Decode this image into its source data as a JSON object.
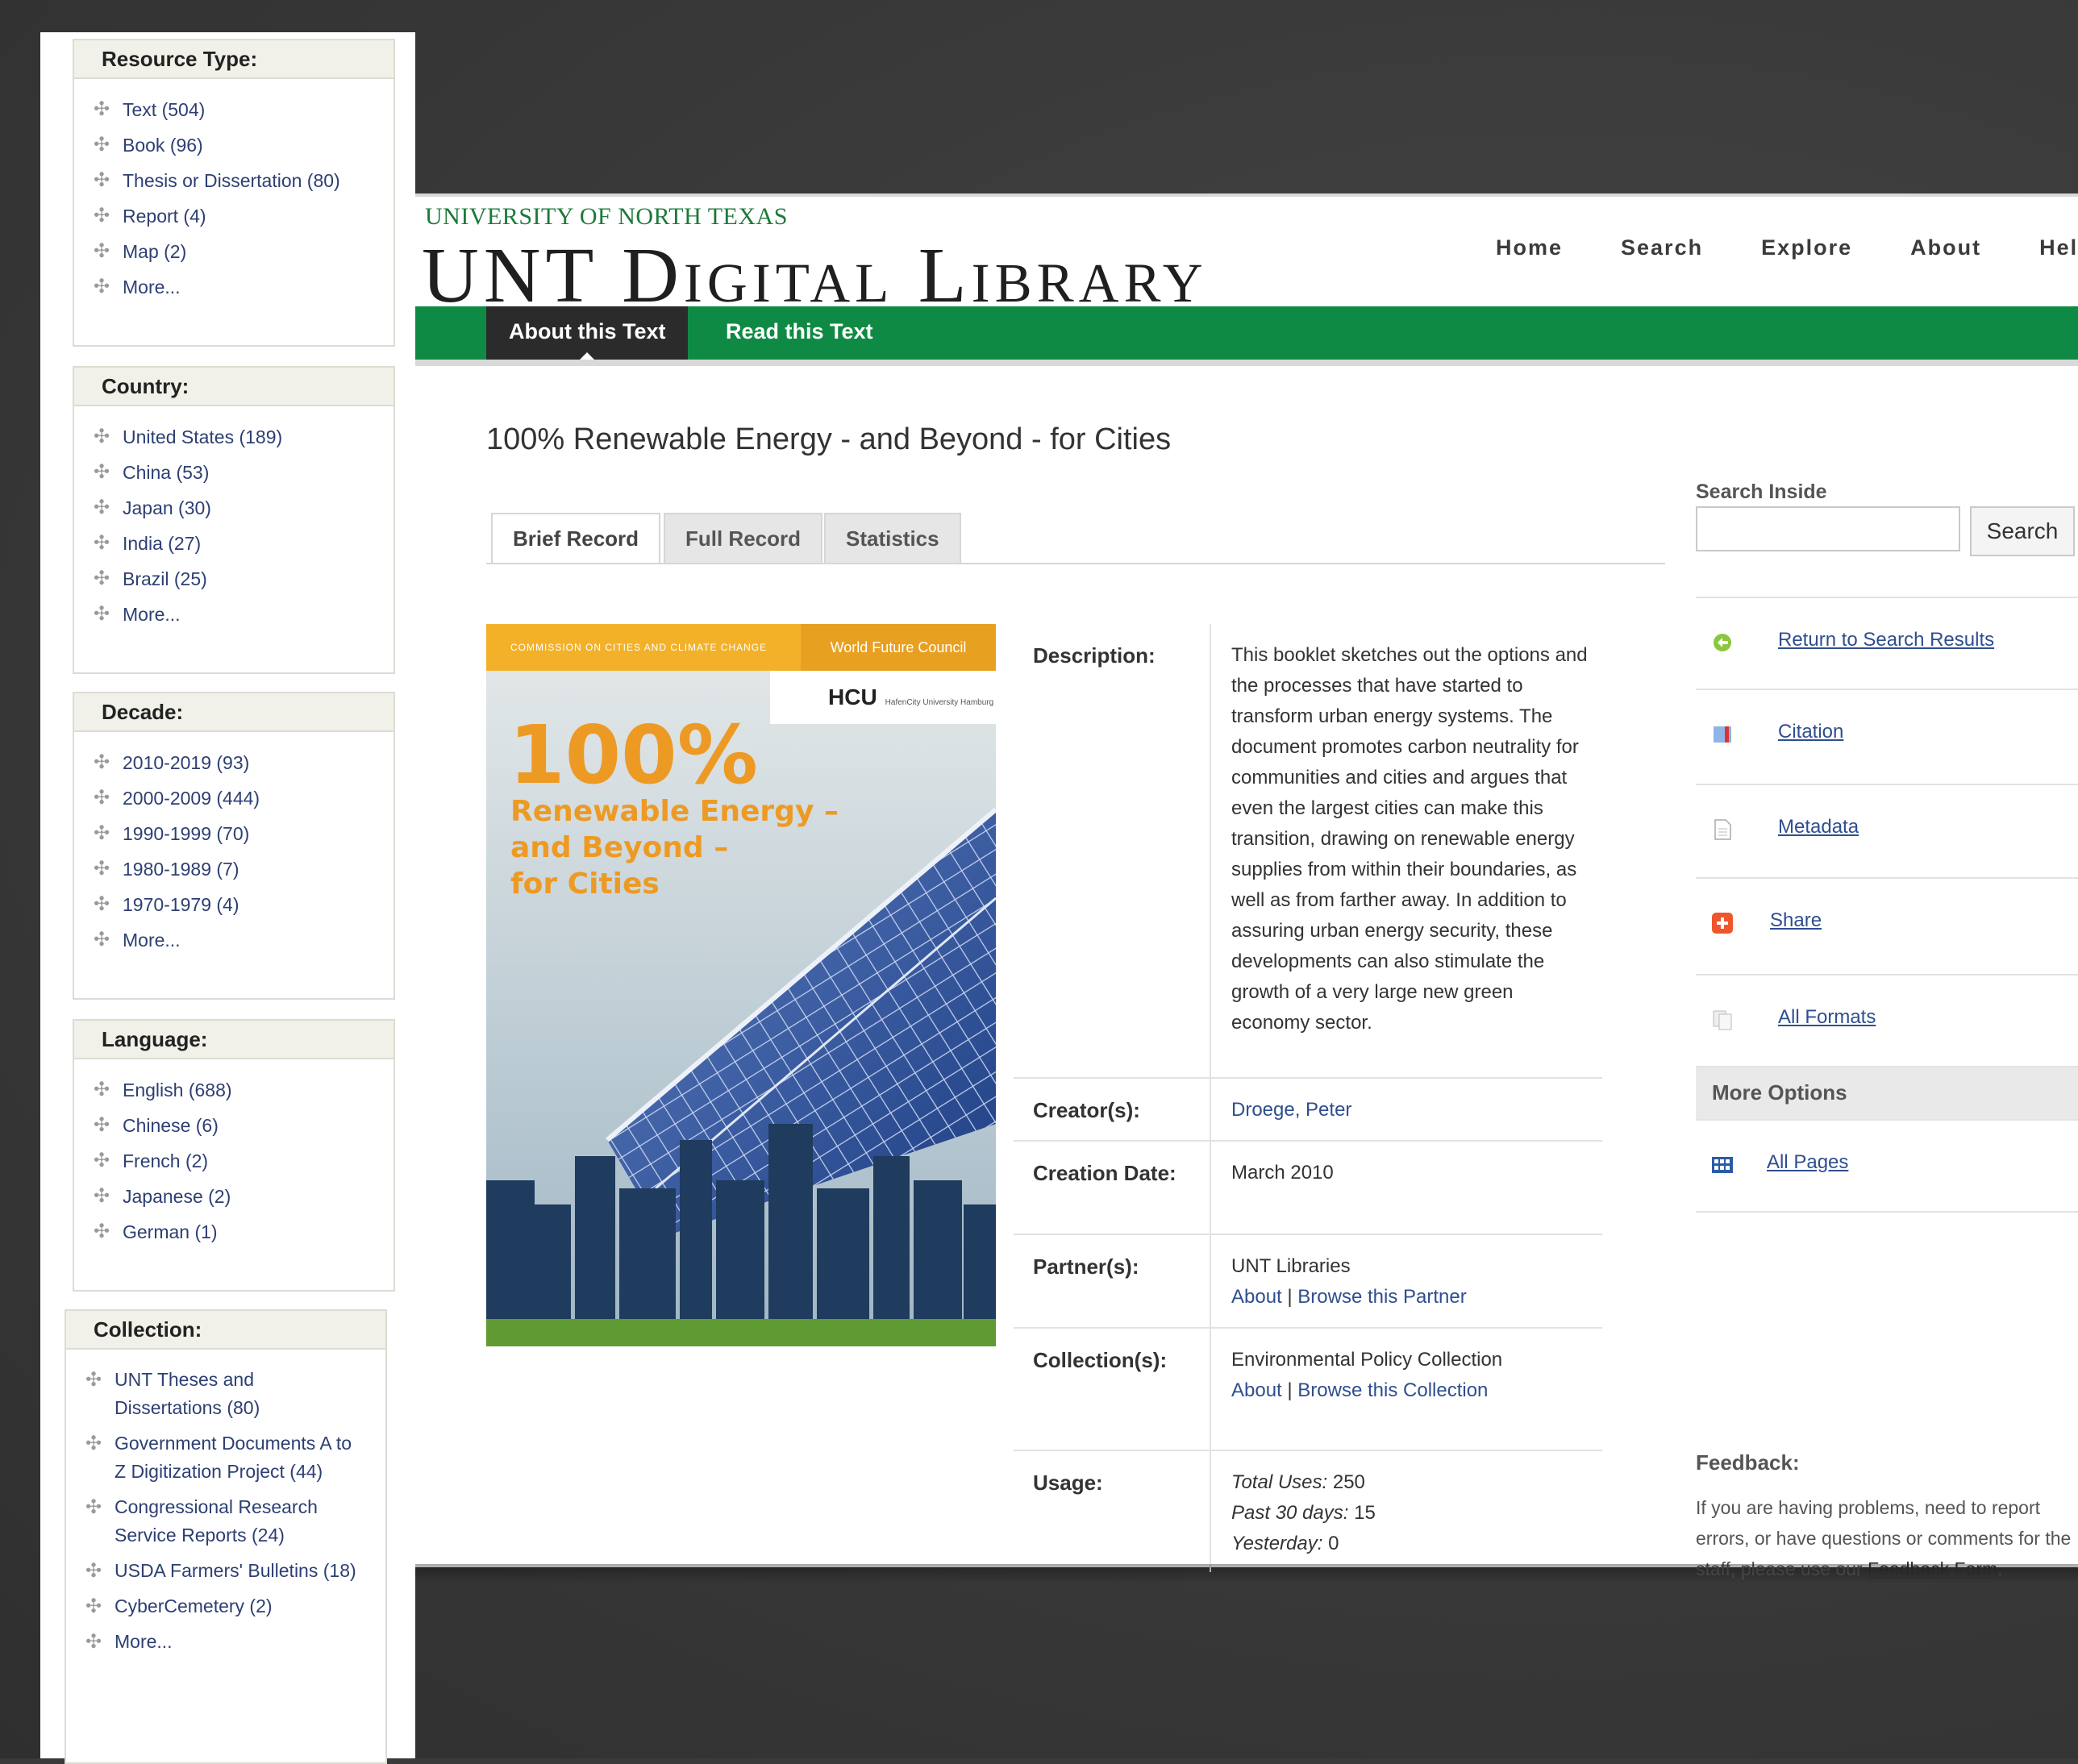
{
  "facets": [
    {
      "title": "Resource Type:",
      "items": [
        "Text (504)",
        "Book (96)",
        "Thesis or Dissertation (80)",
        "Report (4)",
        "Map (2)",
        "More..."
      ]
    },
    {
      "title": "Country:",
      "items": [
        "United States (189)",
        "China (53)",
        "Japan (30)",
        "India (27)",
        "Brazil (25)",
        "More..."
      ]
    },
    {
      "title": "Decade:",
      "items": [
        "2010-2019 (93)",
        "2000-2009 (444)",
        "1990-1999 (70)",
        "1980-1989 (7)",
        "1970-1979 (4)",
        "More..."
      ]
    },
    {
      "title": "Language:",
      "items": [
        "English (688)",
        "Chinese (6)",
        "French (2)",
        "Japanese (2)",
        "German (1)"
      ]
    },
    {
      "title": "Collection:",
      "items": [
        "UNT Theses and Dissertations (80)",
        "Government Documents A to Z Digitization Project (44)",
        "Congressional Research Service Reports (24)",
        "USDA Farmers' Bulletins (18)",
        "CyberCemetery (2)",
        "More..."
      ]
    }
  ],
  "header": {
    "university": "UNIVERSITY OF NORTH TEXAS",
    "site_title": "UNT Digital Library",
    "nav": [
      "Home",
      "Search",
      "Explore",
      "About",
      "Help"
    ]
  },
  "subnav": {
    "active": "About this Text",
    "second": "Read this Text"
  },
  "title": "100% Renewable Energy - and Beyond - for Cities",
  "record_tabs": [
    "Brief Record",
    "Full Record",
    "Statistics"
  ],
  "cover": {
    "band_text": "COMMISSION ON CITIES AND CLIMATE CHANGE",
    "wfc": "World Future Council",
    "hcu": "HCU",
    "hcu_small": "HafenCity University Hamburg",
    "big": "100%",
    "sub": "Renewable Energy –\nand Beyond –\nfor Cities"
  },
  "record": {
    "description_label": "Description:",
    "description": "This booklet sketches out the options and the processes that have started to transform urban energy systems. The document promotes carbon neutrality for communities and cities and argues that even the largest cities can make this transition, drawing on renewable energy supplies from within their boundaries, as well as from farther away. In addition to assuring urban energy security, these developments can also stimulate the growth of a very large new green economy sector.",
    "creator_label": "Creator(s):",
    "creator": "Droege, Peter",
    "creation_date_label": "Creation Date:",
    "creation_date": "March 2010",
    "partner_label": "Partner(s):",
    "partner": "UNT Libraries",
    "partner_about": "About",
    "partner_browse": "Browse this Partner",
    "collection_label": "Collection(s):",
    "collection": "Environmental Policy Collection",
    "collection_about": "About",
    "collection_browse": "Browse this Collection",
    "usage_label": "Usage:",
    "total_uses_label": "Total Uses:",
    "total_uses": "250",
    "past30_label": "Past 30 days:",
    "past30": "15",
    "yesterday_label": "Yesterday:",
    "yesterday": "0",
    "separator": "|"
  },
  "sidebar_right": {
    "search_label": "Search Inside",
    "search_placeholder": "",
    "search_button": "Search",
    "links": [
      "Return to Search Results",
      "Citation",
      "Metadata",
      "Share",
      "All Formats"
    ],
    "more_options": "More Options",
    "all_pages": "All Pages",
    "feedback_title": "Feedback:",
    "feedback_text": "If you are having problems, need to report errors, or have questions or comments for the staff, please use our",
    "feedback_link": "Feedback Form",
    "feedback_end": "."
  },
  "colors": {
    "green": "#0f8a44",
    "dark_tab": "#2b2b2b",
    "link": "#2f4e8f",
    "cover_orange": "#ed9a24"
  }
}
